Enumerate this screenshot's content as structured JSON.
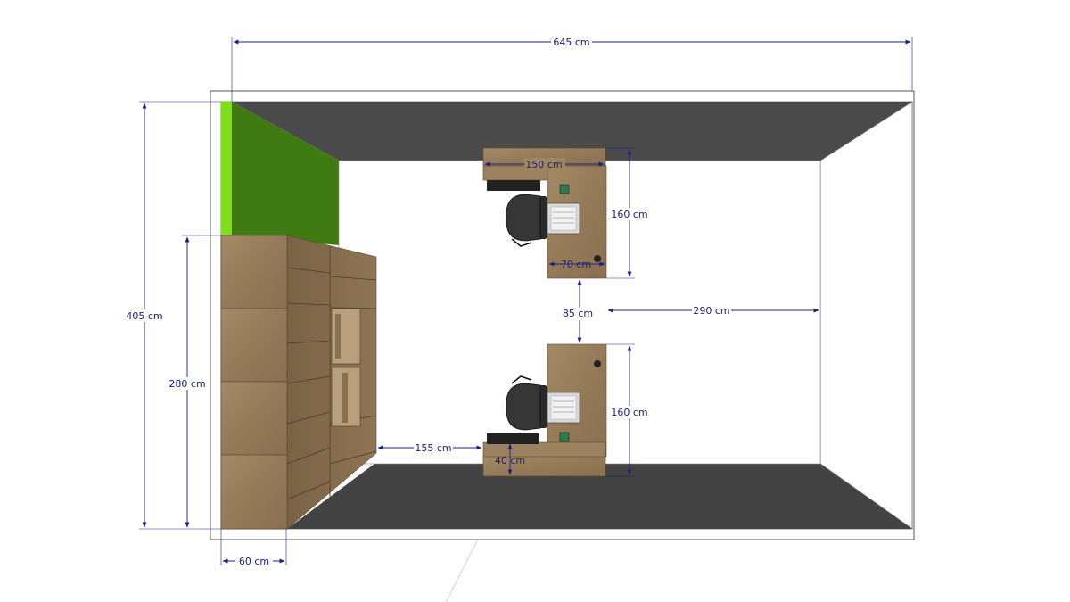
{
  "colors": {
    "dimension": "#1a237e",
    "wall_dark": "#4a4a4a",
    "wall_green": "#3f7a12",
    "wall_green_edge": "#7ede1a",
    "wood": "#a08560",
    "wood_dark": "#7d6548",
    "floor": "#ffffff"
  },
  "dimensions": {
    "room_width": "645 cm",
    "room_depth": "405 cm",
    "cabinet_length": "280 cm",
    "cabinet_depth": "60 cm",
    "desk_top_width": "150 cm",
    "desk_top_depth": "160 cm",
    "desk_top_return": "70 cm",
    "desk_gap": "85 cm",
    "clearance_right": "290 cm",
    "desk_bottom_depth": "160 cm",
    "clearance_left": "155 cm",
    "desk_bottom_return": "40 cm"
  },
  "furniture": {
    "desks": 2,
    "chairs": 2,
    "laptops": 2,
    "cabinet_columns": 2
  }
}
